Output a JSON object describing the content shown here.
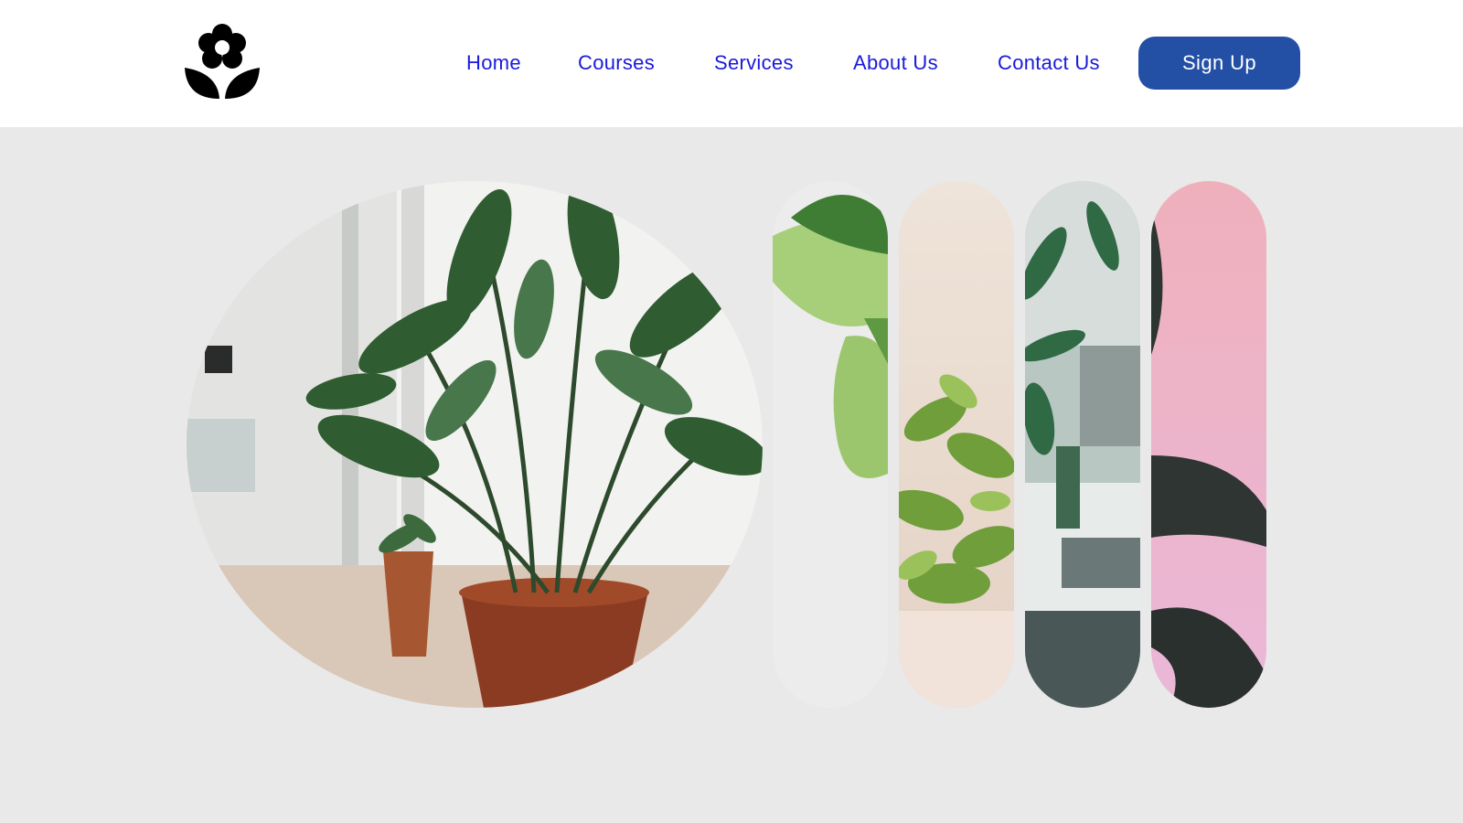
{
  "header": {
    "logo_icon": "flower-icon",
    "nav": [
      {
        "label": "Home"
      },
      {
        "label": "Courses"
      },
      {
        "label": "Services"
      },
      {
        "label": "About Us"
      },
      {
        "label": "Contact Us"
      }
    ],
    "signup_label": "Sign Up"
  },
  "hero": {
    "images": [
      {
        "name": "potted-plant-circle-image",
        "icon": "plant-photo"
      },
      {
        "name": "green-leaf-pill-image",
        "icon": "plant-photo"
      },
      {
        "name": "pothos-pot-pill-image",
        "icon": "plant-photo"
      },
      {
        "name": "living-room-plant-pill-image",
        "icon": "plant-photo"
      },
      {
        "name": "pink-leaf-pill-image",
        "icon": "plant-photo"
      }
    ]
  },
  "colors": {
    "nav_link": "#1a1adb",
    "button_bg": "#2350a5",
    "page_bg": "#e9e9e9",
    "header_bg": "#ffffff"
  }
}
